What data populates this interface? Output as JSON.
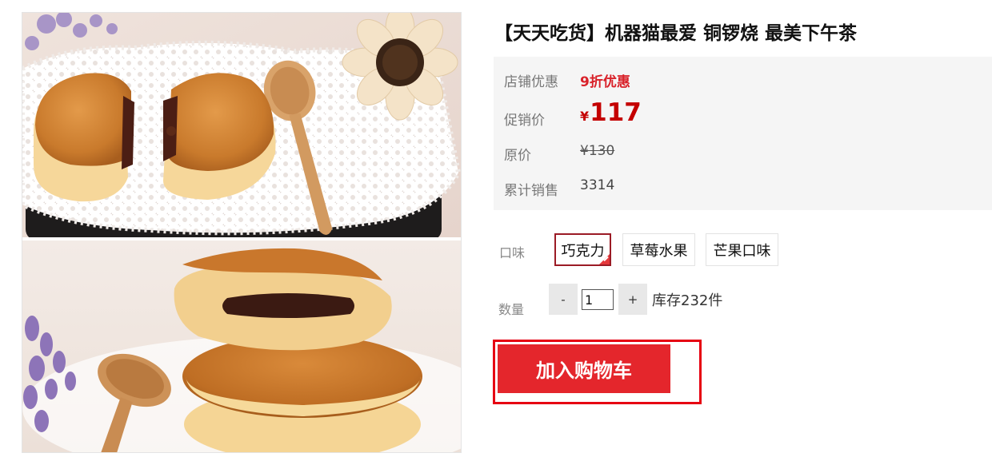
{
  "product": {
    "title": "【天天吃货】机器猫最爱 铜锣烧 最美下午茶",
    "images": [
      "dorayaki-split-photo",
      "dorayaki-stack-photo"
    ]
  },
  "pricing": {
    "promo_label": "店铺优惠",
    "promo_value": "9折优惠",
    "price_label": "促销价",
    "currency": "¥",
    "price": "117",
    "original_label": "原价",
    "original_price": "¥130",
    "sales_label": "累计销售",
    "sales_count": "3314"
  },
  "flavor": {
    "label": "口味",
    "options": [
      "巧克力",
      "草莓水果",
      "芒果口味"
    ],
    "selected": "巧克力"
  },
  "quantity": {
    "label": "数量",
    "minus": "-",
    "plus": "+",
    "value": "1",
    "stock": "库存232件"
  },
  "cart": {
    "button_label": "加入购物车"
  },
  "colors": {
    "accent": "#e4262c",
    "price": "#c40000",
    "selected_border": "#9b1b25",
    "panel_bg": "#f5f5f5"
  }
}
